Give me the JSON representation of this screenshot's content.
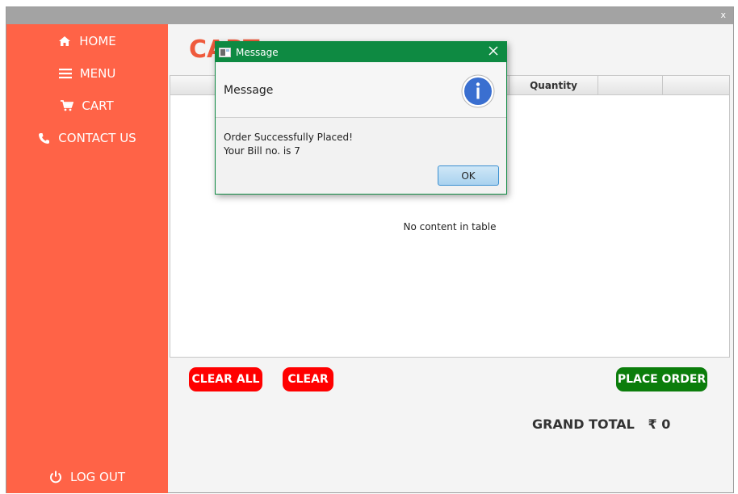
{
  "window": {
    "close_label": "x"
  },
  "sidebar": {
    "items": [
      {
        "label": "HOME",
        "icon": "home-icon"
      },
      {
        "label": "MENU",
        "icon": "menu-icon"
      },
      {
        "label": "CART",
        "icon": "cart-icon"
      },
      {
        "label": "CONTACT US",
        "icon": "phone-icon"
      }
    ],
    "logout": {
      "label": "LOG OUT",
      "icon": "power-icon"
    }
  },
  "main": {
    "title": "CART",
    "table": {
      "columns": [
        "",
        "Quantity",
        "",
        ""
      ],
      "empty_message": "No content in table"
    },
    "buttons": {
      "clear_all": "CLEAR ALL",
      "clear": "CLEAR",
      "place_order": "PLACE ORDER"
    },
    "grand_total": "GRAND TOTAL   ₹ 0"
  },
  "dialog": {
    "title": "Message",
    "header": "Message",
    "lines": [
      "Order Successfully Placed!",
      "Your Bill no. is 7"
    ],
    "ok_label": "OK"
  },
  "colors": {
    "sidebar": "#ff6347",
    "title": "#ef5a3c",
    "danger": "#ff0000",
    "success": "#0b7d0b",
    "dialog_titlebar": "#0e8a42"
  }
}
